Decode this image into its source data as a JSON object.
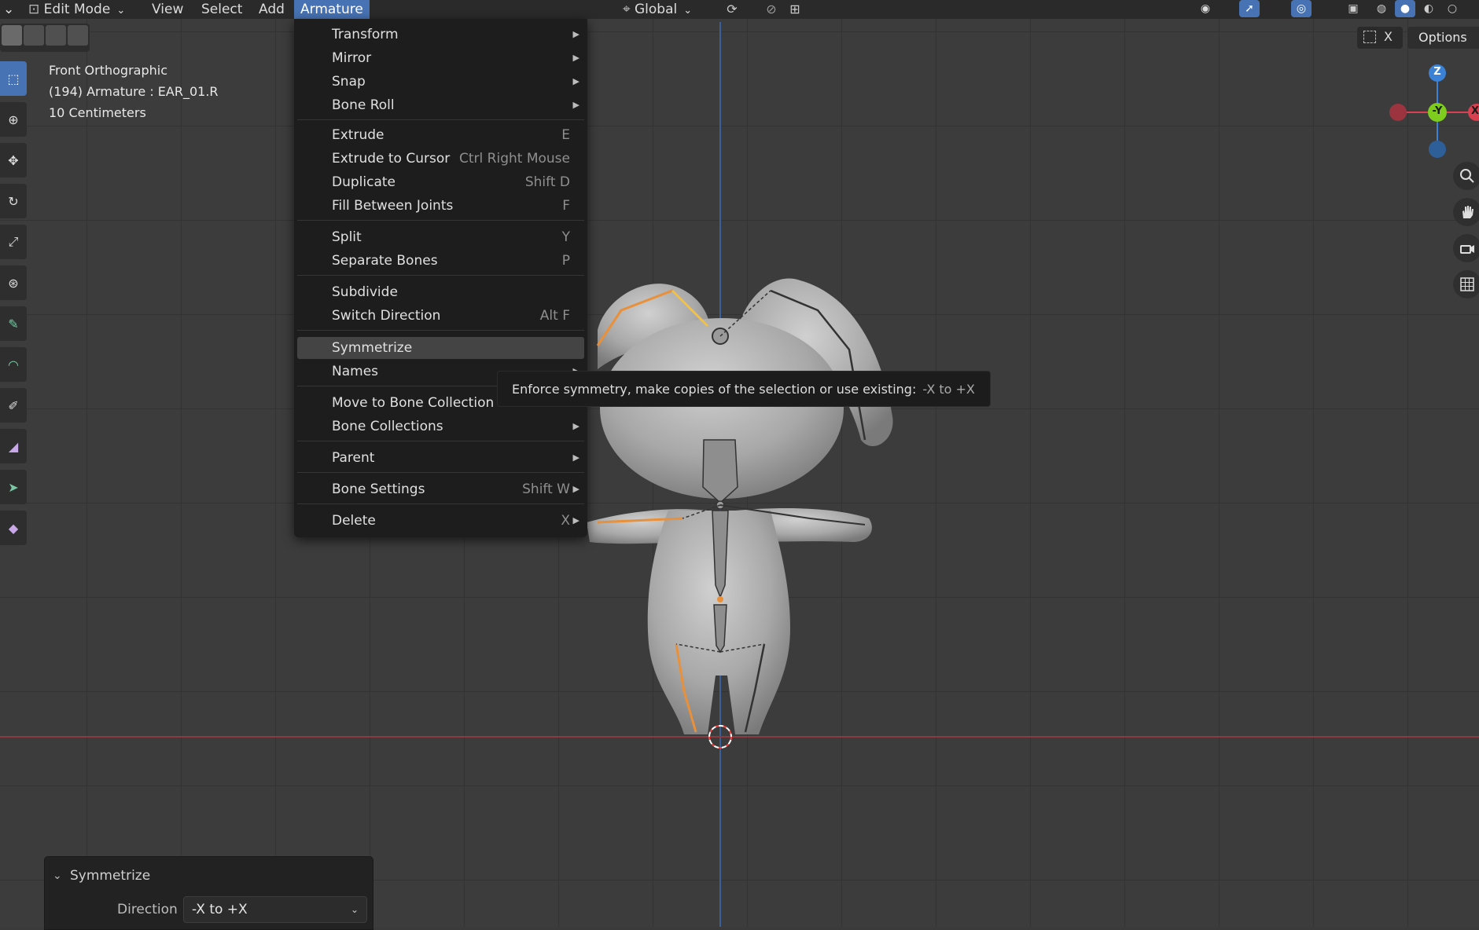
{
  "header": {
    "mode": "Edit Mode",
    "menus": [
      "View",
      "Select",
      "Add",
      "Armature"
    ],
    "active_menu": "Armature",
    "orientation": "Global"
  },
  "viewport": {
    "view_name": "Front Orthographic",
    "object_info": "(194) Armature : EAR_01.R",
    "scale_info": "10 Centimeters",
    "options_label": "Options",
    "gizmo_toggle_label": "X",
    "axes": {
      "z": "Z",
      "y": "-Y",
      "x": "X"
    }
  },
  "armature_menu": {
    "transform": "Transform",
    "mirror": "Mirror",
    "snap": "Snap",
    "bone_roll": "Bone Roll",
    "extrude": "Extrude",
    "extrude_sc": "E",
    "extrude_to_cursor": "Extrude to Cursor",
    "extrude_to_cursor_sc": "Ctrl Right Mouse",
    "duplicate": "Duplicate",
    "duplicate_sc": "Shift D",
    "fill_between_joints": "Fill Between Joints",
    "fill_between_joints_sc": "F",
    "split": "Split",
    "split_sc": "Y",
    "separate_bones": "Separate Bones",
    "separate_bones_sc": "P",
    "subdivide": "Subdivide",
    "switch_direction": "Switch Direction",
    "switch_direction_sc": "Alt F",
    "symmetrize": "Symmetrize",
    "names": "Names",
    "move_to_bone_collection": "Move to Bone Collection",
    "bone_collections": "Bone Collections",
    "parent": "Parent",
    "bone_settings": "Bone Settings",
    "bone_settings_sc": "Shift W",
    "delete": "Delete",
    "delete_sc": "X"
  },
  "tooltip": {
    "text": "Enforce symmetry, make copies of the selection or use existing:",
    "hint": "-X to +X"
  },
  "redo_panel": {
    "title": "Symmetrize",
    "direction_label": "Direction",
    "direction_value": "-X to +X"
  },
  "colors": {
    "accent": "#4772b3",
    "selected_bone": "#e8903a",
    "axis_x": "#d9404f",
    "axis_y": "#7dcc1e",
    "axis_z": "#3b82d6"
  }
}
